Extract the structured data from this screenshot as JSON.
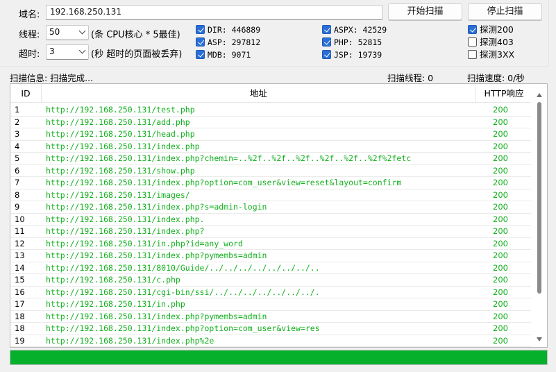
{
  "config": {
    "domain_label": "域名:",
    "domain_value": "192.168.250.131",
    "start_button": "开始扫描",
    "stop_button": "停止扫描",
    "threads_label": "线程:",
    "threads_value": "50",
    "threads_hint": "(条 CPU核心 * 5最佳)",
    "timeout_label": "超时:",
    "timeout_value": "3",
    "timeout_hint": "(秒 超时的页面被丢弃)"
  },
  "dictionaries": [
    {
      "label": "DIR: 446889",
      "checked": true
    },
    {
      "label": "ASP: 297812",
      "checked": true
    },
    {
      "label": "MDB: 9071",
      "checked": true
    },
    {
      "label": "ASPX: 42529",
      "checked": true
    },
    {
      "label": "PHP: 52815",
      "checked": true
    },
    {
      "label": "JSP: 19739",
      "checked": true
    }
  ],
  "probes": [
    {
      "label": "探测200",
      "checked": true
    },
    {
      "label": "探测403",
      "checked": false
    },
    {
      "label": "探测3XX",
      "checked": false
    }
  ],
  "status": {
    "info": "扫描信息: 扫描完成...",
    "threads": "扫描线程: 0",
    "speed": "扫描速度: 0/秒"
  },
  "table": {
    "columns": [
      "ID",
      "地址",
      "HTTP响应"
    ],
    "rows": [
      {
        "id": "1",
        "url": "http://192.168.250.131/test.php",
        "code": "200"
      },
      {
        "id": "2",
        "url": "http://192.168.250.131/add.php",
        "code": "200"
      },
      {
        "id": "3",
        "url": "http://192.168.250.131/head.php",
        "code": "200"
      },
      {
        "id": "4",
        "url": "http://192.168.250.131/index.php",
        "code": "200"
      },
      {
        "id": "5",
        "url": "http://192.168.250.131/index.php?chemin=..%2f..%2f..%2f..%2f..%2f..%2f%2fetc",
        "code": "200"
      },
      {
        "id": "6",
        "url": "http://192.168.250.131/show.php",
        "code": "200"
      },
      {
        "id": "7",
        "url": "http://192.168.250.131/index.php?option=com_user&view=reset&layout=confirm",
        "code": "200"
      },
      {
        "id": "8",
        "url": "http://192.168.250.131/images/",
        "code": "200"
      },
      {
        "id": "9",
        "url": "http://192.168.250.131/index.php?s=admin-login",
        "code": "200"
      },
      {
        "id": "10",
        "url": "http://192.168.250.131/index.php.",
        "code": "200"
      },
      {
        "id": "11",
        "url": "http://192.168.250.131/index.php?",
        "code": "200"
      },
      {
        "id": "12",
        "url": "http://192.168.250.131/in.php?id=any_word",
        "code": "200"
      },
      {
        "id": "13",
        "url": "http://192.168.250.131/index.php?pymembs=admin",
        "code": "200"
      },
      {
        "id": "14",
        "url": "http://192.168.250.131/8010/Guide/../../../../../../../..",
        "code": "200"
      },
      {
        "id": "15",
        "url": "http://192.168.250.131/c.php",
        "code": "200"
      },
      {
        "id": "16",
        "url": "http://192.168.250.131/cgi-bin/ssi/../../../../../../../.",
        "code": "200"
      },
      {
        "id": "17",
        "url": "http://192.168.250.131/in.php",
        "code": "200"
      },
      {
        "id": "18",
        "url": "http://192.168.250.131/index.php?pymembs=admin",
        "code": "200"
      },
      {
        "id": "18",
        "url": "http://192.168.250.131/index.php?option=com_user&view=res",
        "code": "200"
      },
      {
        "id": "19",
        "url": "http://192.168.250.131/index.php%2e",
        "code": "200"
      }
    ]
  },
  "progress": {
    "percent": 100,
    "color": "#07b02a"
  },
  "colors": {
    "url_text": "#13b01e",
    "checkbox_on": "#2a6fd6"
  }
}
